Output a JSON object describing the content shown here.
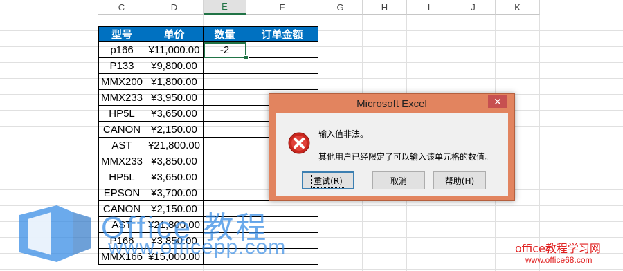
{
  "columns": [
    "C",
    "D",
    "E",
    "F",
    "G",
    "H",
    "I",
    "J",
    "K"
  ],
  "selected_column": "E",
  "table": {
    "headers": [
      "型号",
      "单价",
      "数量",
      "订单金额"
    ],
    "rows": [
      [
        "p166",
        "¥11,000.00",
        "-2",
        ""
      ],
      [
        "P133",
        "¥9,800.00",
        "",
        ""
      ],
      [
        "MMX200",
        "¥1,800.00",
        "",
        ""
      ],
      [
        "MMX233",
        "¥3,950.00",
        "",
        ""
      ],
      [
        "HP5L",
        "¥3,650.00",
        "",
        ""
      ],
      [
        "CANON",
        "¥2,150.00",
        "",
        ""
      ],
      [
        "AST",
        "¥21,800.00",
        "",
        ""
      ],
      [
        "MMX233",
        "¥3,850.00",
        "",
        ""
      ],
      [
        "HP5L",
        "¥3,650.00",
        "",
        ""
      ],
      [
        "EPSON",
        "¥3,700.00",
        "",
        ""
      ],
      [
        "CANON",
        "¥2,150.00",
        "",
        ""
      ],
      [
        "AST",
        "¥21,800.00",
        "",
        ""
      ],
      [
        "P166",
        "¥3,850.00",
        "",
        ""
      ],
      [
        "MMX166",
        "¥15,000.00",
        "",
        ""
      ]
    ]
  },
  "dialog": {
    "title": "Microsoft Excel",
    "close_label": "✕",
    "icon": "error-icon",
    "message_line1": "输入值非法。",
    "message_line2": "其他用户已经限定了可以输入该单元格的数值。",
    "buttons": {
      "retry": "重试(R)",
      "cancel": "取消",
      "help": "帮助(H)"
    }
  },
  "watermark": {
    "line1": "Office 教程",
    "line2": "www.officepp.com",
    "site_title": "office教程学习网",
    "site_url": "www.office68.com"
  },
  "colors": {
    "header_fill": "#0071c1",
    "dialog_frame": "#e2845f",
    "excel_green": "#217346",
    "watermark_blue": "#3a8ee6",
    "watermark_red": "#e02020"
  }
}
